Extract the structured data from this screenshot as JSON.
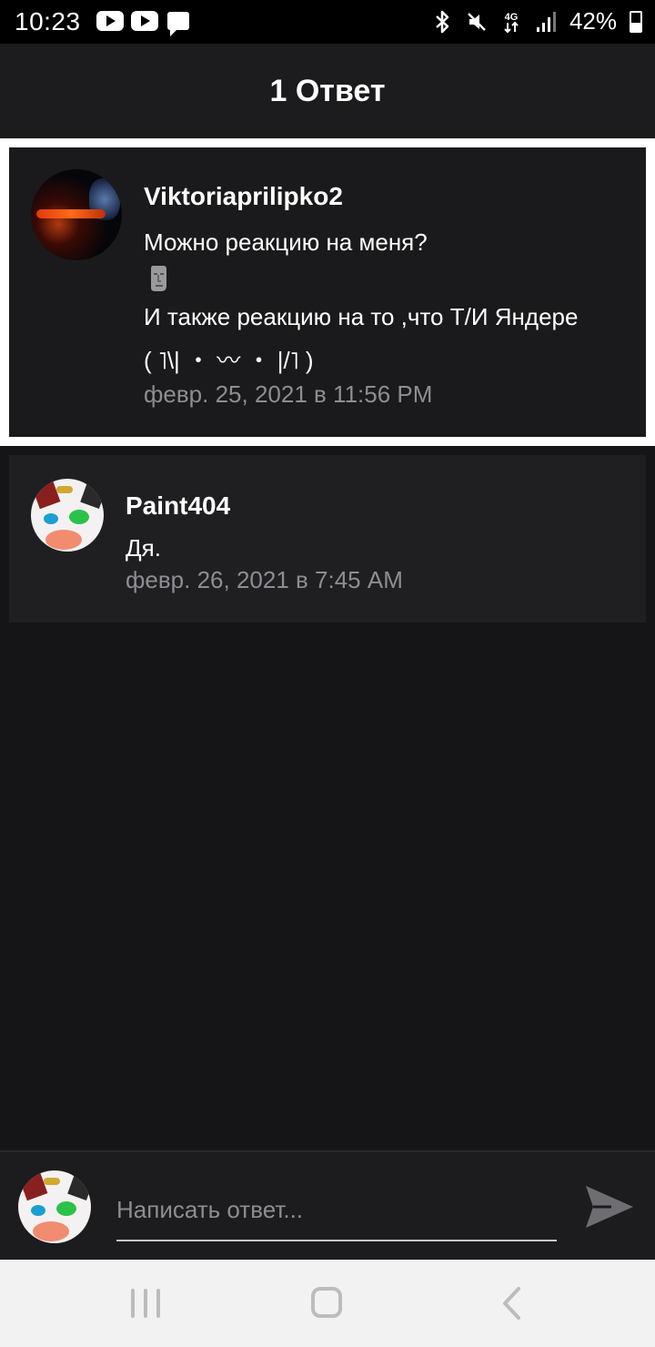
{
  "status_bar": {
    "time": "10:23",
    "battery": "42%",
    "network": "4G",
    "icons": [
      "youtube-icon",
      "youtube-icon",
      "message-icon",
      "bluetooth-icon",
      "mute-icon",
      "network-4g-icon",
      "signal-icon",
      "battery-icon"
    ]
  },
  "header": {
    "title": "1 Ответ"
  },
  "parent_comment": {
    "username": "Viktoriaprilipko2",
    "line1": "Можно реакцию на меня?",
    "emoji_icon": "moai-icon",
    "line2": "И также реакцию на то ,что Т/И Яндере",
    "line3": "( ˥\\| ・ 〰 ・ |/˥ )",
    "timestamp": "февр. 25, 2021 в 11:56 PM"
  },
  "reply": {
    "username": "Paint404",
    "text": "Дя.",
    "timestamp": "февр. 26, 2021 в 7:45 AM"
  },
  "compose": {
    "placeholder": "Написать ответ..."
  },
  "colors": {
    "background": "#151417",
    "header": "#1c1b1d",
    "timestamp": "#8e8d93",
    "parent_border": "#ffffff",
    "nav_bar": "#f2f2f2"
  }
}
